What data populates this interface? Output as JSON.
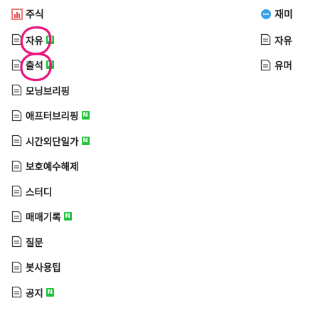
{
  "left_section": {
    "title": "주식",
    "items": [
      {
        "label": "자유",
        "new": "N"
      },
      {
        "label": "출석",
        "new": "N"
      },
      {
        "label": "모닝브리핑",
        "new": ""
      },
      {
        "label": "애프터브리핑",
        "new": "N"
      },
      {
        "label": "시간외단일가",
        "new": "N"
      },
      {
        "label": "보호예수해제",
        "new": ""
      },
      {
        "label": "스터디",
        "new": ""
      },
      {
        "label": "매매기록",
        "new": "N"
      },
      {
        "label": "질문",
        "new": ""
      },
      {
        "label": "봇사용팁",
        "new": ""
      },
      {
        "label": "공지",
        "new": "N"
      }
    ]
  },
  "right_section": {
    "title": "재미",
    "items": [
      {
        "label": "자유"
      },
      {
        "label": "유머"
      }
    ]
  },
  "colors": {
    "badge_green": "#1fc43a",
    "annotation_pink": "#e8157c",
    "header_icon_red": "#e84545",
    "header_icon_blue": "#3aa0e8"
  }
}
